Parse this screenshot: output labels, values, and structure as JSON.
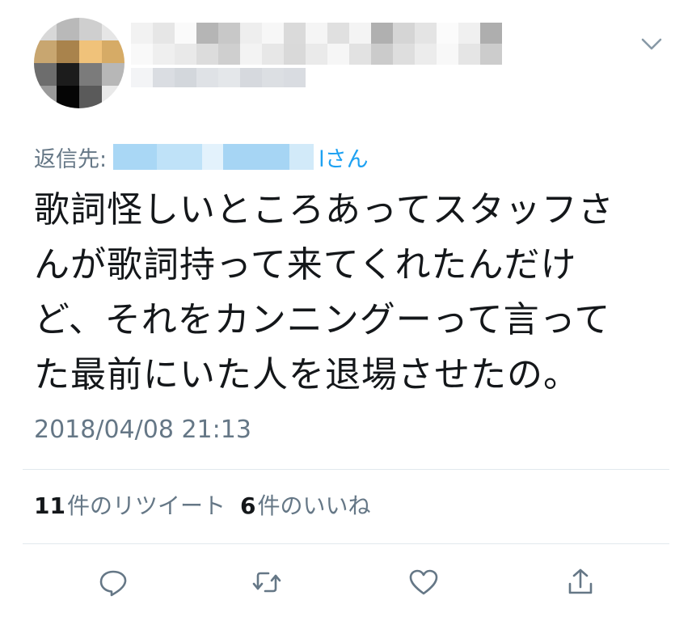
{
  "tweet": {
    "reply_prefix": "返信先:",
    "reply_suffix": "lさん",
    "text_lines": [
      "歌詞怪しいところあってスタッフさ",
      "んが歌詞持って来てくれたんだけ",
      "ど、それをカンニングーって言って",
      "た最前にいた人を退場させたの。"
    ],
    "timestamp": "2018/04/08 21:13"
  },
  "stats": {
    "retweet_count": "11",
    "retweet_label": "件のリツイート",
    "like_count": "6",
    "like_label": "件のいいね"
  },
  "icons": {
    "menu": "chevron-down-icon",
    "reply": "reply-icon",
    "retweet": "retweet-icon",
    "like": "heart-icon",
    "share": "share-icon"
  },
  "colors": {
    "accent": "#1da1f2",
    "secondary_text": "#657786",
    "primary_text": "#14171a",
    "divider": "#e1e8ed"
  }
}
